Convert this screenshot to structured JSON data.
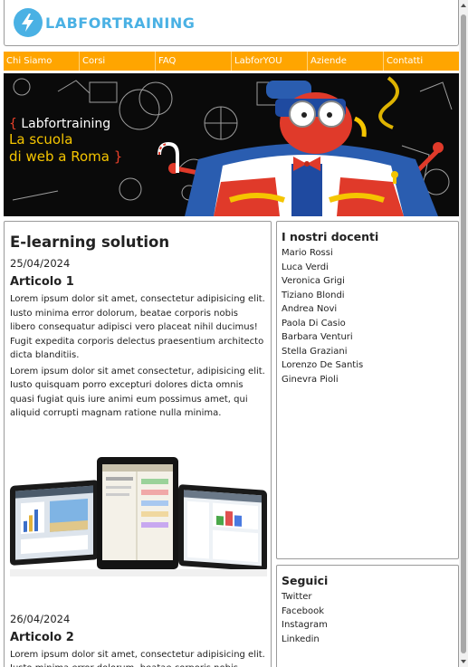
{
  "site": {
    "logo_text": "LABFORTRAINING",
    "brand_color": "#4ab1e4",
    "nav_color": "#ffa500"
  },
  "nav": [
    {
      "label": "Chi Siamo"
    },
    {
      "label": "Corsi"
    },
    {
      "label": "FAQ"
    },
    {
      "label": "LabforYOU"
    },
    {
      "label": "Aziende"
    },
    {
      "label": "Contatti"
    }
  ],
  "banner": {
    "brand": "Labfortraining",
    "line1": "La scuola",
    "line2": "di web a Roma"
  },
  "main": {
    "title": "E-learning solution",
    "articles": [
      {
        "date": "25/04/2024",
        "title": "Articolo 1",
        "paragraphs": [
          "Lorem ipsum dolor sit amet, consectetur adipisicing elit. Iusto minima error dolorum, beatae corporis nobis libero consequatur adipisci vero placeat nihil ducimus! Fugit expedita corporis delectus praesentium architecto dicta blanditiis.",
          "Lorem ipsum dolor sit amet consectetur, adipisicing elit. Iusto quisquam porro excepturi dolores dicta omnis quasi fugiat quis iure animi eum possimus amet, qui aliquid corrupti magnam ratione nulla minima."
        ]
      },
      {
        "date": "26/04/2024",
        "title": "Articolo 2",
        "paragraphs": [
          "Lorem ipsum dolor sit amet, consectetur adipisicing elit. Iusto minima error dolorum, beatae corporis nobis libero"
        ]
      }
    ]
  },
  "docenti": {
    "title": "I nostri docenti",
    "items": [
      "Mario Rossi",
      "Luca Verdi",
      "Veronica Grigi",
      "Tiziano Blondi",
      "Andrea Novi",
      "Paola Di Casio",
      "Barbara Venturi",
      "Stella Graziani",
      "Lorenzo De Santis",
      "Ginevra Pioli"
    ]
  },
  "seguici": {
    "title": "Seguici",
    "items": [
      "Twitter",
      "Facebook",
      "Instagram",
      "Linkedin"
    ]
  }
}
